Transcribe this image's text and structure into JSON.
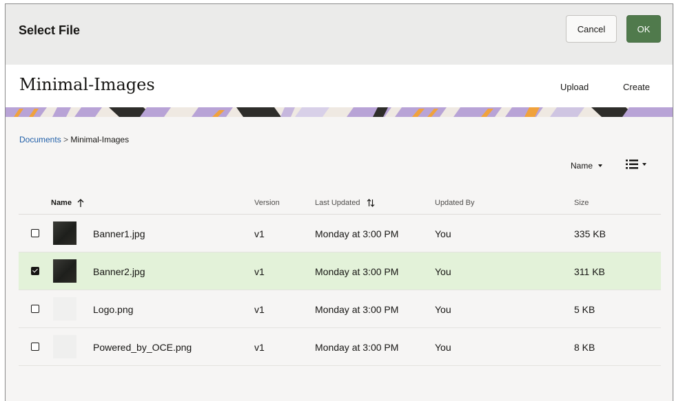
{
  "dialog": {
    "title": "Select File",
    "cancel_label": "Cancel",
    "ok_label": "OK"
  },
  "folder": {
    "title": "Minimal-Images",
    "upload_label": "Upload",
    "create_label": "Create"
  },
  "breadcrumb": {
    "root": "Documents",
    "separator": ">",
    "current": "Minimal-Images"
  },
  "toolbar": {
    "sort_label": "Name",
    "view_icon": "list-view-icon"
  },
  "table": {
    "columns": {
      "name": "Name",
      "version": "Version",
      "last_updated": "Last Updated",
      "updated_by": "Updated By",
      "size": "Size"
    },
    "rows": [
      {
        "name": "Banner1.jpg",
        "version": "v1",
        "last_updated": "Monday at 3:00 PM",
        "updated_by": "You",
        "size": "335 KB",
        "selected": false
      },
      {
        "name": "Banner2.jpg",
        "version": "v1",
        "last_updated": "Monday at 3:00 PM",
        "updated_by": "You",
        "size": "311 KB",
        "selected": true
      },
      {
        "name": "Logo.png",
        "version": "v1",
        "last_updated": "Monday at 3:00 PM",
        "updated_by": "You",
        "size": "5 KB",
        "selected": false
      },
      {
        "name": "Powered_by_OCE.png",
        "version": "v1",
        "last_updated": "Monday at 3:00 PM",
        "updated_by": "You",
        "size": "8 KB",
        "selected": false
      }
    ]
  },
  "colors": {
    "ok_button": "#507a4c",
    "selected_row": "#e3f2d9",
    "link": "#1f5ea8",
    "banner_purple": "#b8a3d6",
    "banner_orange": "#f0a23c"
  }
}
